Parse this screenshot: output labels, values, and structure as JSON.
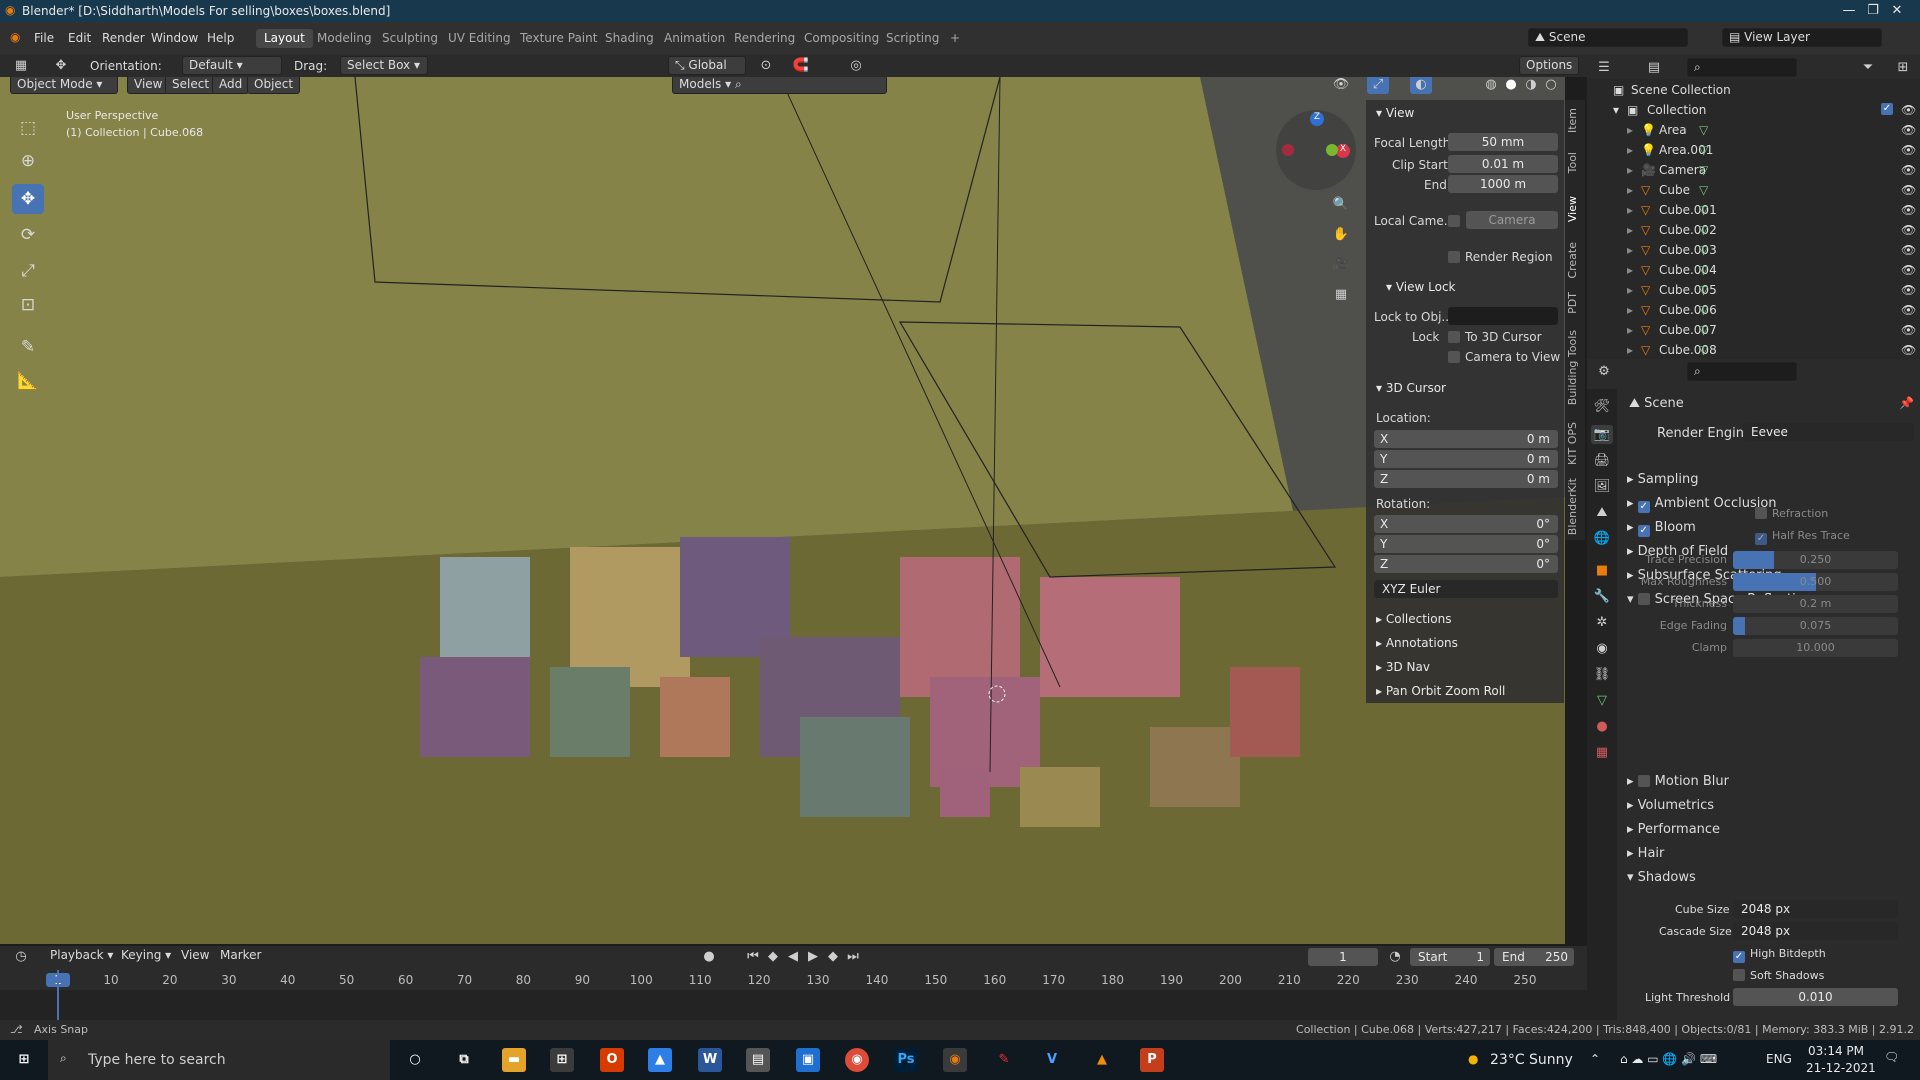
{
  "window": {
    "title": "Blender* [D:\\Siddharth\\Models For selling\\boxes\\boxes.blend]"
  },
  "menu": [
    "File",
    "Edit",
    "Render",
    "Window",
    "Help"
  ],
  "workspaces": [
    "Layout",
    "Modeling",
    "Sculpting",
    "UV Editing",
    "Texture Paint",
    "Shading",
    "Animation",
    "Rendering",
    "Compositing",
    "Scripting"
  ],
  "scene": {
    "name": "Scene",
    "view_layer": "View Layer"
  },
  "tool_header": {
    "orientation_label": "Orientation:",
    "orientation": "Default",
    "drag_label": "Drag:",
    "drag": "Select Box",
    "transform": "Global",
    "options": "Options"
  },
  "viewport_header": {
    "mode": "Object Mode",
    "view": "View",
    "select": "Select",
    "add": "Add",
    "object": "Object",
    "collection": "Models"
  },
  "viewport": {
    "perspective": "User Perspective",
    "collection_info": "(1) Collection | Cube.068"
  },
  "npanel": {
    "view_title": "View",
    "focal_length_label": "Focal Length",
    "focal_length": "50 mm",
    "clip_start_label": "Clip Start",
    "clip_start": "0.01 m",
    "end_label": "End",
    "clip_end": "1000 m",
    "local_camera_label": "Local Came...",
    "local_camera": "Camera",
    "render_region": "Render Region",
    "view_lock_title": "View Lock",
    "lock_obj_label": "Lock to Obj...",
    "lock_label": "Lock",
    "to_cursor": "To 3D Cursor",
    "camera_to_view": "Camera to View",
    "cursor_title": "3D Cursor",
    "location_label": "Location:",
    "rotation_label": "Rotation:",
    "loc": [
      {
        "axis": "X",
        "val": "0 m"
      },
      {
        "axis": "Y",
        "val": "0 m"
      },
      {
        "axis": "Z",
        "val": "0 m"
      }
    ],
    "rot": [
      {
        "axis": "X",
        "val": "0°"
      },
      {
        "axis": "Y",
        "val": "0°"
      },
      {
        "axis": "Z",
        "val": "0°"
      }
    ],
    "rotation_mode": "XYZ Euler",
    "sections": [
      "Collections",
      "Annotations",
      "3D Nav",
      "Pan Orbit Zoom Roll"
    ],
    "tabs": [
      "Item",
      "Tool",
      "View",
      "Create",
      "PDT",
      "Building Tools",
      "KIT OPS",
      "BlenderKit"
    ]
  },
  "outliner": {
    "root": "Scene Collection",
    "collection": "Collection",
    "items": [
      "Area",
      "Area.001",
      "Camera",
      "Cube",
      "Cube.001",
      "Cube.002",
      "Cube.003",
      "Cube.004",
      "Cube.005",
      "Cube.006",
      "Cube.007",
      "Cube.008"
    ]
  },
  "properties": {
    "scene_label": "Scene",
    "render_engine_label": "Render Engine",
    "render_engine": "Eevee",
    "panels": [
      {
        "label": "Sampling",
        "check": null
      },
      {
        "label": "Ambient Occlusion",
        "check": true
      },
      {
        "label": "Bloom",
        "check": true
      },
      {
        "label": "Depth of Field",
        "check": null
      },
      {
        "label": "Subsurface Scattering",
        "check": null
      },
      {
        "label": "Screen Space Reflections",
        "check": false
      }
    ],
    "ssr": {
      "refraction": "Refraction",
      "half_res": "Half Res Trace",
      "trace_precision_label": "Trace Precision",
      "trace_precision": "0.250",
      "trace_precision_fill": 0.25,
      "max_roughness_label": "Max Roughness",
      "max_roughness": "0.500",
      "max_roughness_fill": 0.5,
      "thickness_label": "Thickness",
      "thickness": "0.2 m",
      "edge_fading_label": "Edge Fading",
      "edge_fading": "0.075",
      "edge_fading_fill": 0.075,
      "clamp_label": "Clamp",
      "clamp": "10.000"
    },
    "panels2": [
      {
        "label": "Motion Blur",
        "check": false
      },
      {
        "label": "Volumetrics",
        "check": null
      },
      {
        "label": "Performance",
        "check": null
      },
      {
        "label": "Hair",
        "check": null
      },
      {
        "label": "Shadows",
        "check": null
      }
    ],
    "shadows": {
      "cube_size_label": "Cube Size",
      "cube_size": "2048 px",
      "cascade_size_label": "Cascade Size",
      "cascade_size": "2048 px",
      "high_bitdepth": "High Bitdepth",
      "soft_shadows": "Soft Shadows",
      "light_threshold_label": "Light Threshold",
      "light_threshold": "0.010"
    }
  },
  "timeline": {
    "playback": "Playback",
    "keying": "Keying",
    "view": "View",
    "marker": "Marker",
    "current_frame": "1",
    "start_label": "Start",
    "start": "1",
    "end_label": "End",
    "end": "250",
    "ticks": [
      "1",
      "10",
      "20",
      "30",
      "40",
      "50",
      "60",
      "70",
      "80",
      "90",
      "100",
      "110",
      "120",
      "130",
      "140",
      "150",
      "160",
      "170",
      "180",
      "190",
      "200",
      "210",
      "220",
      "230",
      "240",
      "250"
    ]
  },
  "status": {
    "hint": "Axis Snap",
    "info": "Collection | Cube.068 | Verts:427,217 | Faces:424,200 | Tris:848,400 | Objects:0/81 | Memory: 383.3 MiB | 2.91.2"
  },
  "taskbar": {
    "search": "Type here to search",
    "weather": "23°C  Sunny",
    "lang": "ENG",
    "time": "03:14 PM",
    "date": "21-12-2021"
  },
  "colors": {
    "accent": "#4772b3",
    "titlebar": "#17384d",
    "viewport_floor": "#6f6a35"
  }
}
